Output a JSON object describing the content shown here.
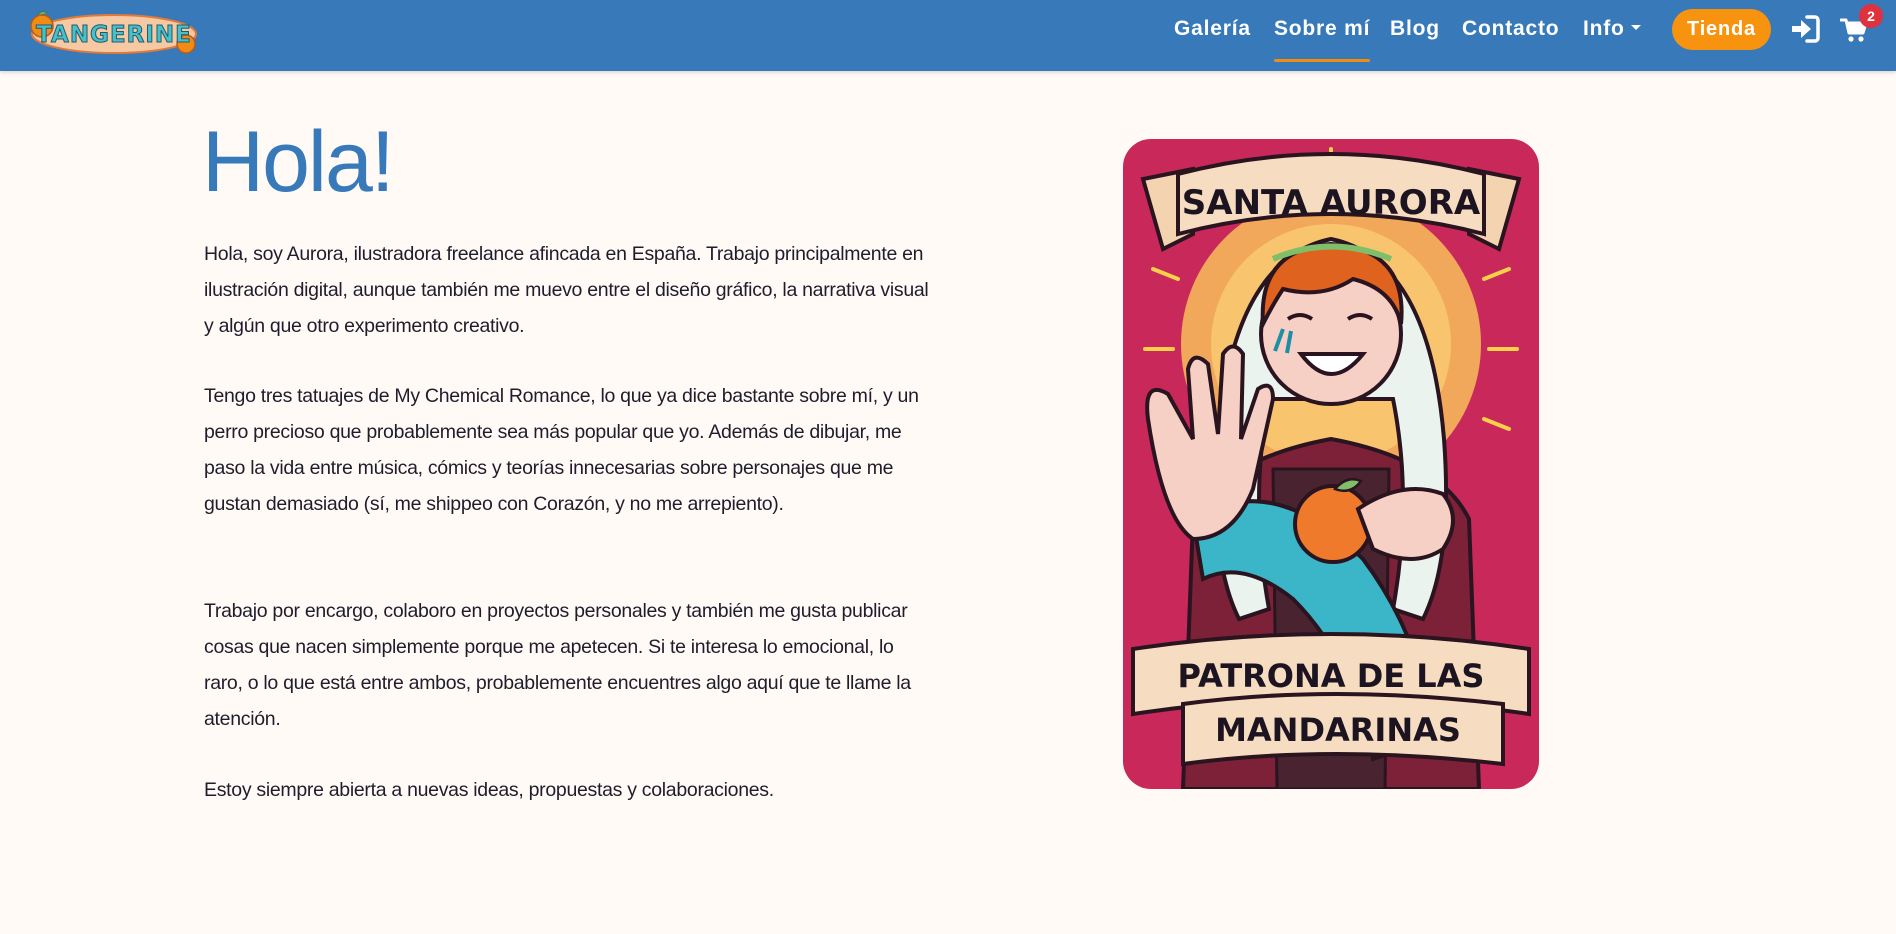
{
  "header": {
    "logo_text": "TANGERINE",
    "nav": {
      "gallery": "Galería",
      "about": "Sobre mí",
      "blog": "Blog",
      "contact": "Contacto",
      "info": "Info",
      "shop": "Tienda"
    },
    "cart_count": "2",
    "login_icon": "sign-in-icon",
    "cart_icon": "shopping-cart-icon"
  },
  "main": {
    "title": "Hola!",
    "paragraphs": [
      "Hola, soy Aurora, ilustradora freelance afincada en España. Trabajo principalmente en ilustración digital, aunque también me muevo entre el diseño gráfico, la narrativa visual y algún que otro experimento creativo.",
      "Tengo tres tatuajes de My Chemical Romance, lo que ya dice bastante sobre mí, y un perro precioso que probablemente sea más popular que yo. Además de dibujar, me paso la vida entre música, cómics y teorías innecesarias sobre personajes que me gustan demasiado (sí, me shippeo con Corazón, y no me arrepiento).",
      "Trabajo por encargo, colaboro en proyectos personales y también me gusta publicar cosas que nacen simplemente porque me apetecen. Si te interesa lo emocional, lo raro, o lo que está entre ambos, probablemente encuentres algo aquí que te llame la atención.",
      "Estoy siempre abierta a nuevas ideas, propuestas y colaboraciones."
    ],
    "illustration": {
      "banner_top": "SANTA AURORA",
      "banner_bottom_line1": "PATRONA DE LAS",
      "banner_bottom_line2": "MANDARINAS"
    }
  },
  "colors": {
    "nav_bg": "#3779b9",
    "accent": "#f7930e",
    "title": "#3779b9",
    "page_bg": "#fffaf6",
    "badge": "#e0313f",
    "card_bg": "#c9285a"
  }
}
